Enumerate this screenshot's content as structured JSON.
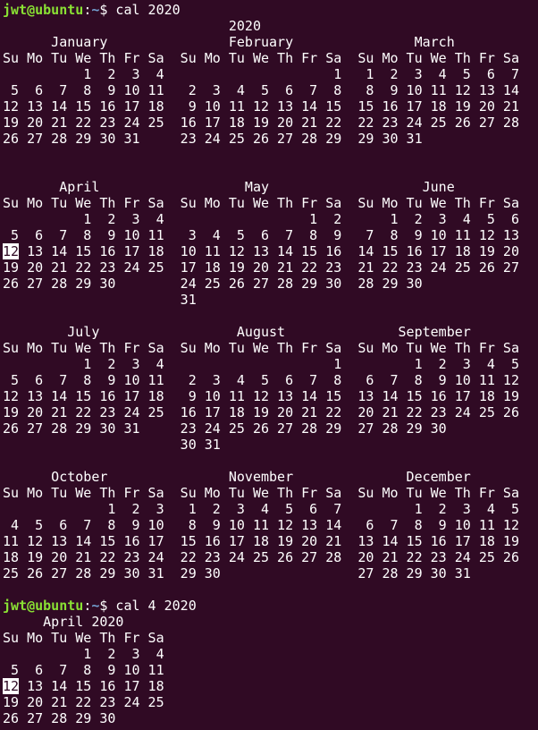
{
  "terminal": {
    "colors": {
      "background": "#300a24",
      "text": "#ffffff",
      "prompt_user": "#8ae234",
      "prompt_path": "#729fcf",
      "highlight_bg": "#ffffff",
      "highlight_fg": "#300a24"
    },
    "lines": [
      {
        "type": "prompt",
        "user": "jwt@ubuntu",
        "sep": ":",
        "path": "~",
        "symbol": "$",
        "command": " cal 2020"
      },
      {
        "type": "text",
        "text": "                            2020"
      },
      {
        "type": "text",
        "text": "      January               February               March"
      },
      {
        "type": "text",
        "text": "Su Mo Tu We Th Fr Sa  Su Mo Tu We Th Fr Sa  Su Mo Tu We Th Fr Sa"
      },
      {
        "type": "text",
        "text": "          1  2  3  4                     1   1  2  3  4  5  6  7"
      },
      {
        "type": "text",
        "text": " 5  6  7  8  9 10 11   2  3  4  5  6  7  8   8  9 10 11 12 13 14"
      },
      {
        "type": "text",
        "text": "12 13 14 15 16 17 18   9 10 11 12 13 14 15  15 16 17 18 19 20 21"
      },
      {
        "type": "text",
        "text": "19 20 21 22 23 24 25  16 17 18 19 20 21 22  22 23 24 25 26 27 28"
      },
      {
        "type": "text",
        "text": "26 27 28 29 30 31     23 24 25 26 27 28 29  29 30 31"
      },
      {
        "type": "text",
        "text": ""
      },
      {
        "type": "text",
        "text": ""
      },
      {
        "type": "text",
        "text": "       April                  May                   June"
      },
      {
        "type": "text",
        "text": "Su Mo Tu We Th Fr Sa  Su Mo Tu We Th Fr Sa  Su Mo Tu We Th Fr Sa"
      },
      {
        "type": "text",
        "text": "          1  2  3  4                  1  2      1  2  3  4  5  6"
      },
      {
        "type": "text",
        "text": " 5  6  7  8  9 10 11   3  4  5  6  7  8  9   7  8  9 10 11 12 13"
      },
      {
        "type": "highlight",
        "before": "",
        "highlight": "12",
        "after": " 13 14 15 16 17 18  10 11 12 13 14 15 16  14 15 16 17 18 19 20"
      },
      {
        "type": "text",
        "text": "19 20 21 22 23 24 25  17 18 19 20 21 22 23  21 22 23 24 25 26 27"
      },
      {
        "type": "text",
        "text": "26 27 28 29 30        24 25 26 27 28 29 30  28 29 30"
      },
      {
        "type": "text",
        "text": "                      31"
      },
      {
        "type": "text",
        "text": ""
      },
      {
        "type": "text",
        "text": "        July                 August              September"
      },
      {
        "type": "text",
        "text": "Su Mo Tu We Th Fr Sa  Su Mo Tu We Th Fr Sa  Su Mo Tu We Th Fr Sa"
      },
      {
        "type": "text",
        "text": "          1  2  3  4                     1         1  2  3  4  5"
      },
      {
        "type": "text",
        "text": " 5  6  7  8  9 10 11   2  3  4  5  6  7  8   6  7  8  9 10 11 12"
      },
      {
        "type": "text",
        "text": "12 13 14 15 16 17 18   9 10 11 12 13 14 15  13 14 15 16 17 18 19"
      },
      {
        "type": "text",
        "text": "19 20 21 22 23 24 25  16 17 18 19 20 21 22  20 21 22 23 24 25 26"
      },
      {
        "type": "text",
        "text": "26 27 28 29 30 31     23 24 25 26 27 28 29  27 28 29 30"
      },
      {
        "type": "text",
        "text": "                      30 31"
      },
      {
        "type": "text",
        "text": ""
      },
      {
        "type": "text",
        "text": "      October               November              December"
      },
      {
        "type": "text",
        "text": "Su Mo Tu We Th Fr Sa  Su Mo Tu We Th Fr Sa  Su Mo Tu We Th Fr Sa"
      },
      {
        "type": "text",
        "text": "             1  2  3   1  2  3  4  5  6  7         1  2  3  4  5"
      },
      {
        "type": "text",
        "text": " 4  5  6  7  8  9 10   8  9 10 11 12 13 14   6  7  8  9 10 11 12"
      },
      {
        "type": "text",
        "text": "11 12 13 14 15 16 17  15 16 17 18 19 20 21  13 14 15 16 17 18 19"
      },
      {
        "type": "text",
        "text": "18 19 20 21 22 23 24  22 23 24 25 26 27 28  20 21 22 23 24 25 26"
      },
      {
        "type": "text",
        "text": "25 26 27 28 29 30 31  29 30                 27 28 29 30 31"
      },
      {
        "type": "text",
        "text": ""
      },
      {
        "type": "prompt",
        "user": "jwt@ubuntu",
        "sep": ":",
        "path": "~",
        "symbol": "$",
        "command": " cal 4 2020"
      },
      {
        "type": "text",
        "text": "     April 2020"
      },
      {
        "type": "text",
        "text": "Su Mo Tu We Th Fr Sa"
      },
      {
        "type": "text",
        "text": "          1  2  3  4"
      },
      {
        "type": "text",
        "text": " 5  6  7  8  9 10 11"
      },
      {
        "type": "highlight",
        "before": "",
        "highlight": "12",
        "after": " 13 14 15 16 17 18"
      },
      {
        "type": "text",
        "text": "19 20 21 22 23 24 25"
      },
      {
        "type": "text",
        "text": "26 27 28 29 30"
      }
    ]
  }
}
